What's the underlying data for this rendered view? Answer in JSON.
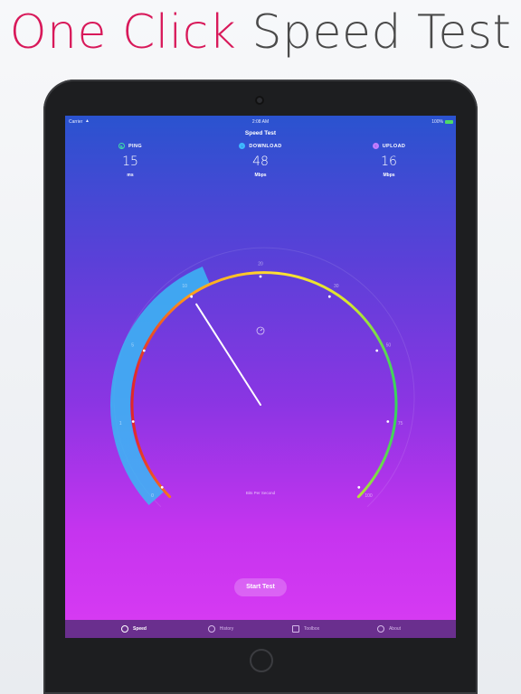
{
  "headline": {
    "accent": "One Click",
    "rest": "Speed Test"
  },
  "status_bar": {
    "carrier": "Carrier",
    "time": "2:08 AM",
    "battery": "100%"
  },
  "nav": {
    "title": "Speed Test"
  },
  "stats": [
    {
      "label": "PING",
      "value": "15",
      "unit": "ms",
      "icon": "ping-icon",
      "color": "#3fe0a7"
    },
    {
      "label": "DOWNLOAD",
      "value": "48",
      "unit": "Mbps",
      "icon": "download-icon",
      "color": "#3fb8ff"
    },
    {
      "label": "UPLOAD",
      "value": "16",
      "unit": "Mbps",
      "icon": "upload-icon",
      "color": "#c27cff"
    }
  ],
  "gauge": {
    "ticks": [
      "0",
      "1",
      "5",
      "10",
      "20",
      "30",
      "50",
      "75",
      "100"
    ],
    "caption": "Bits Per Second",
    "needle_value": "10",
    "arc_colors": [
      "#e02828",
      "#ff9f1a",
      "#ffe033",
      "#38d45c"
    ],
    "progress_color": "#3ab8f5"
  },
  "start_button": {
    "label": "Start Test"
  },
  "tabs": [
    {
      "label": "Speed",
      "icon": "speedometer-icon",
      "active": true
    },
    {
      "label": "History",
      "icon": "clock-icon",
      "active": false
    },
    {
      "label": "Toolbox",
      "icon": "toolbox-icon",
      "active": false
    },
    {
      "label": "About",
      "icon": "info-icon",
      "active": false
    }
  ]
}
